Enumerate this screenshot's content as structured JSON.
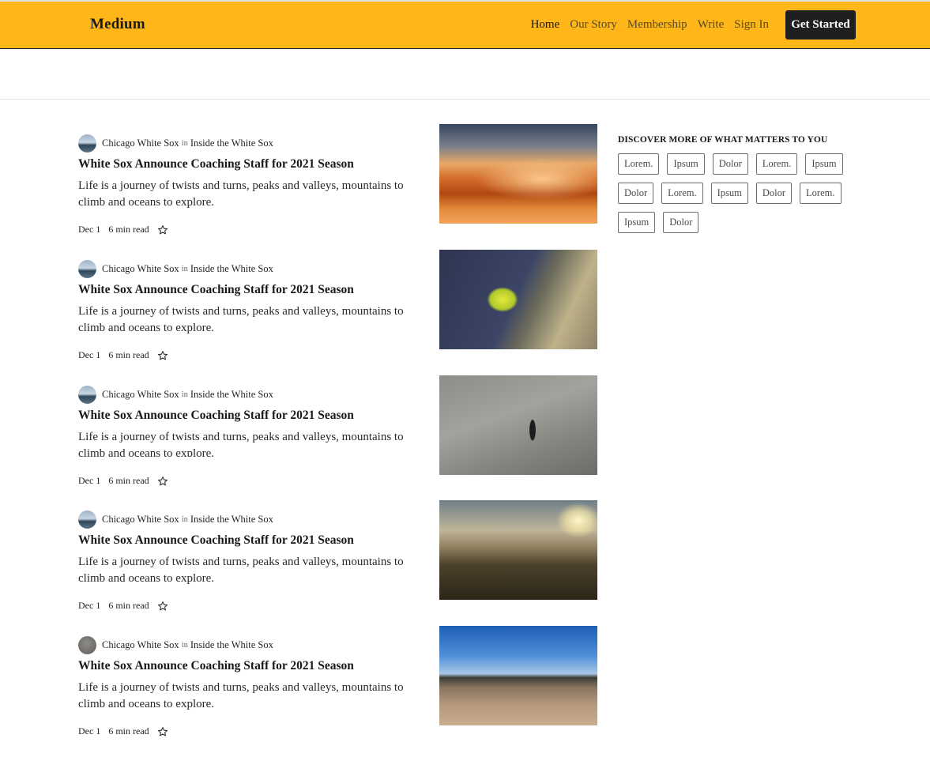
{
  "header": {
    "logo": "Medium",
    "nav": [
      {
        "label": "Home",
        "active": true
      },
      {
        "label": "Our Story",
        "active": false
      },
      {
        "label": "Membership",
        "active": false
      },
      {
        "label": "Write",
        "active": false
      },
      {
        "label": "Sign In",
        "active": false
      }
    ],
    "cta_label": "Get Started",
    "background_color": "#ffb619"
  },
  "articles": [
    {
      "author": "Chicago White Sox",
      "in_word": "in",
      "publication": "Inside the White Sox",
      "title": "White Sox Announce Coaching Staff for 2021 Season",
      "excerpt": "Life is a journey of twists and turns, peaks and valleys, mountains to climb and oceans to explore.",
      "date": "Dec 1",
      "read_time": "6 min read",
      "image": "sunset-clouds-image"
    },
    {
      "author": "Chicago White Sox",
      "in_word": "in",
      "publication": "Inside the White Sox",
      "title": "White Sox Announce Coaching Staff for 2021 Season",
      "excerpt": "Life is a journey of twists and turns, peaks and valleys, mountains to climb and oceans to explore.",
      "date": "Dec 1",
      "read_time": "6 min read",
      "image": "plant-on-rock-image"
    },
    {
      "author": "Chicago White Sox",
      "in_word": "in",
      "publication": "Inside the White Sox",
      "title": "White Sox Announce Coaching Staff for 2021 Season",
      "excerpt": "Life is a journey of twists and turns, peaks and valleys, mountains to climb and oceans to explore.",
      "date": "Dec 1",
      "read_time": "6 min read",
      "image": "man-walking-road-image"
    },
    {
      "author": "Chicago White Sox",
      "in_word": "in",
      "publication": "Inside the White Sox",
      "title": "White Sox Announce Coaching Staff for 2021 Season",
      "excerpt": "Life is a journey of twists and turns, peaks and valleys, mountains to climb and oceans to explore.",
      "date": "Dec 1",
      "read_time": "6 min read",
      "image": "sunlit-valley-image"
    },
    {
      "author": "Chicago White Sox",
      "in_word": "in",
      "publication": "Inside the White Sox",
      "title": "White Sox Announce Coaching Staff for 2021 Season",
      "excerpt": "Life is a journey of twists and turns, peaks and valleys, mountains to climb and oceans to explore.",
      "date": "Dec 1",
      "read_time": "6 min read",
      "image": "wooden-deck-image"
    }
  ],
  "sidebar": {
    "title": "DISCOVER MORE OF WHAT MATTERS TO YOU",
    "tags": [
      "Lorem.",
      "Ipsum",
      "Dolor",
      "Lorem.",
      "Ipsum",
      "Dolor",
      "Lorem.",
      "Ipsum",
      "Dolor",
      "Lorem.",
      "Ipsum",
      "Dolor"
    ]
  }
}
